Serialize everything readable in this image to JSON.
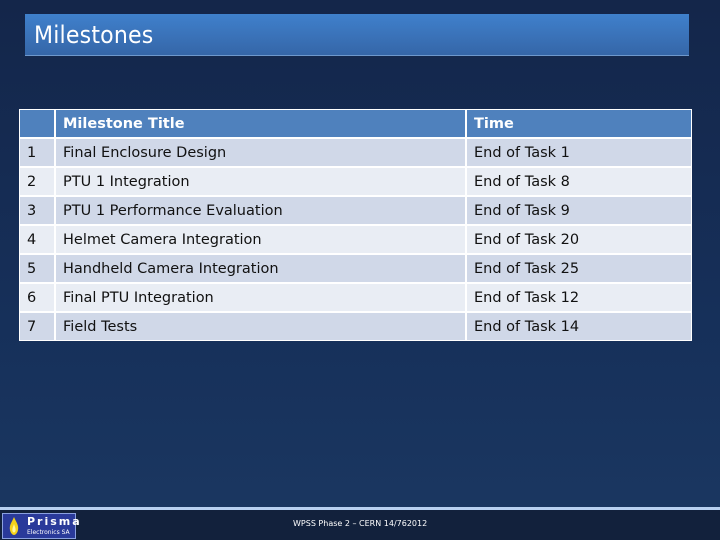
{
  "slide": {
    "title": "Milestones"
  },
  "table": {
    "headers": [
      "",
      "Milestone Title",
      "Time"
    ],
    "rows": [
      {
        "num": "1",
        "title": "Final Enclosure Design",
        "time": "End of Task 1"
      },
      {
        "num": "2",
        "title": "PTU 1 Integration",
        "time": "End of Task 8"
      },
      {
        "num": "3",
        "title": "PTU 1 Performance Evaluation",
        "time": "End of Task 9"
      },
      {
        "num": "4",
        "title": "Helmet Camera Integration",
        "time": "End of Task 20"
      },
      {
        "num": "5",
        "title": "Handheld Camera Integration",
        "time": "End of Task 25"
      },
      {
        "num": "6",
        "title": "Final PTU Integration",
        "time": "End of Task 12"
      },
      {
        "num": "7",
        "title": "Field Tests",
        "time": "End of Task 14"
      }
    ]
  },
  "footer": {
    "logo_name": "Prisma",
    "logo_sub": "Electronics SA",
    "text": "WPSS Phase 2 – CERN 14/762012"
  },
  "colors": {
    "header_bg": "#4f81bd",
    "row_odd": "#d0d8e8",
    "row_even": "#e9edf4",
    "title_bar": "#3a72b8"
  }
}
